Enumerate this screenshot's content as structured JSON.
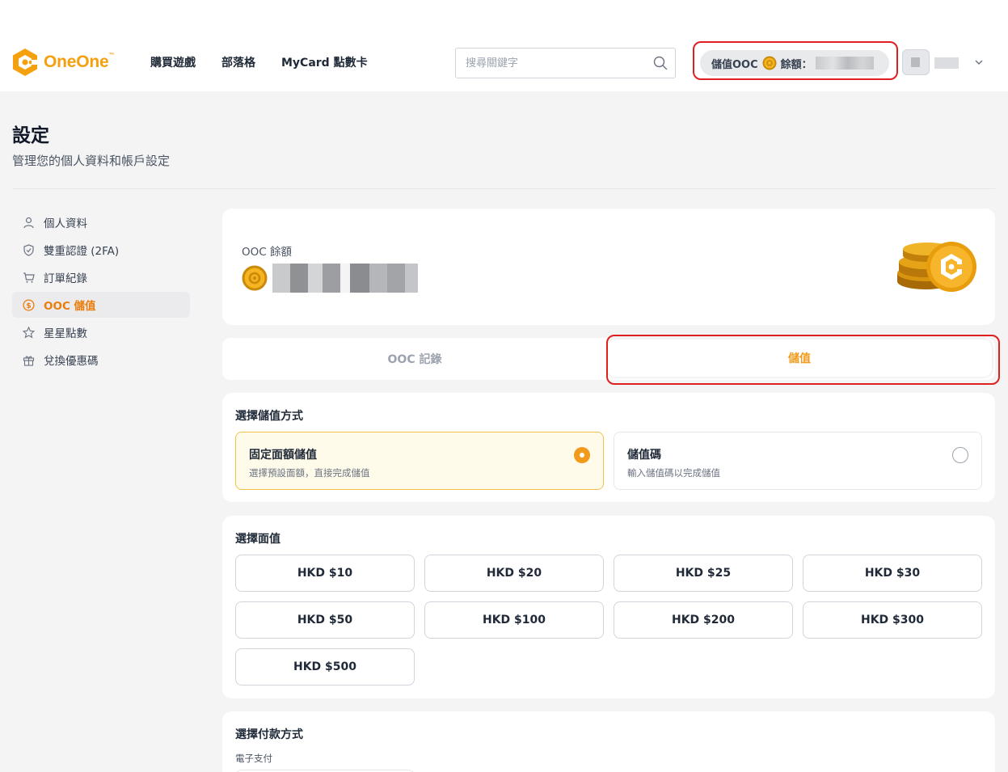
{
  "header": {
    "logo_text": "OneOne",
    "logo_tm": "™",
    "nav": [
      "購買遊戲",
      "部落格",
      "MyCard 點數卡"
    ],
    "search_placeholder": "搜尋關鍵字",
    "topup_label": "儲值OOC",
    "balance_label": "餘額："
  },
  "page": {
    "title": "設定",
    "subtitle": "管理您的個人資料和帳戶設定"
  },
  "sidebar": {
    "items": [
      {
        "label": "個人資料",
        "icon": "user-icon"
      },
      {
        "label": "雙重認證 (2FA)",
        "icon": "shield-icon"
      },
      {
        "label": "訂單紀錄",
        "icon": "cart-icon"
      },
      {
        "label": "OOC 儲值",
        "icon": "dollar-circle-icon",
        "active": true
      },
      {
        "label": "星星點數",
        "icon": "star-icon"
      },
      {
        "label": "兌換優惠碼",
        "icon": "gift-icon"
      }
    ]
  },
  "balance_card": {
    "label": "OOC 餘額"
  },
  "tabs": [
    {
      "label": "OOC 記錄",
      "active": false
    },
    {
      "label": "儲值",
      "active": true
    }
  ],
  "method": {
    "title": "選擇儲值方式",
    "options": [
      {
        "title": "固定面額儲值",
        "desc": "選擇預設面額，直接完成儲值",
        "selected": true
      },
      {
        "title": "儲值碼",
        "desc": "輸入儲值碼以完成儲值",
        "selected": false
      }
    ]
  },
  "amount": {
    "title": "選擇面值",
    "options": [
      "HKD $10",
      "HKD $20",
      "HKD $25",
      "HKD $30",
      "HKD $50",
      "HKD $100",
      "HKD $200",
      "HKD $300",
      "HKD $500"
    ]
  },
  "payment": {
    "title": "選擇付款方式",
    "subtitle": "電子支付"
  },
  "colors": {
    "accent": "#f29a1b",
    "highlight": "#e01f1f",
    "selected_bg": "#fffbeb"
  }
}
